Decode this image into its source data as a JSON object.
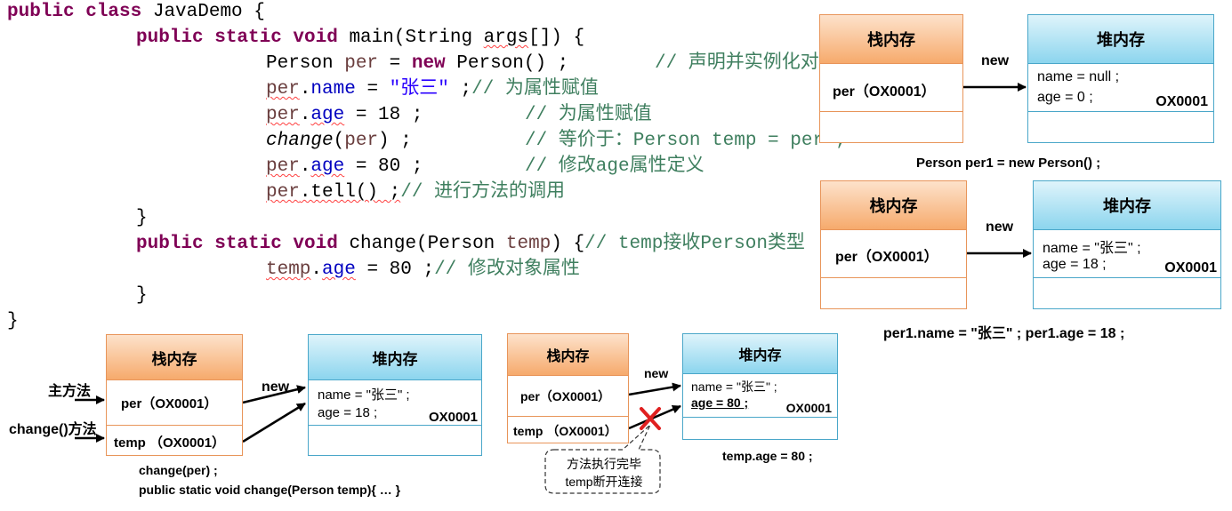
{
  "code": {
    "line1": {
      "kw": "public class",
      "rest": " JavaDemo {"
    },
    "line2": {
      "kw": "public static void",
      "rest": " main(String ",
      "args": "args",
      "tail": "[]) {"
    },
    "line3": {
      "cls": "Person ",
      "var": "per",
      "eq": " = ",
      "kw": "new",
      "rest": " Person() ;",
      "comment": "// 声明并实例化对象"
    },
    "line4": {
      "var": "per",
      "dot": ".",
      "field": "name",
      "eq": " = ",
      "str": "\"张三\"",
      "rest": " ;",
      "comment": "// 为属性赋值"
    },
    "line5": {
      "var": "per",
      "dot": ".",
      "field": "age",
      "rest": " = 18 ;",
      "comment": "// 为属性赋值"
    },
    "line6": {
      "method": "change",
      "open": "(",
      "var": "per",
      "rest": ") ;",
      "comment": "// 等价于：Person temp = per ;"
    },
    "line7": {
      "var": "per",
      "dot": ".",
      "field": "age",
      "rest": " = 80 ;",
      "comment": "// 修改age属性定义"
    },
    "line8": {
      "var": "per",
      "rest": ".tell() ;",
      "comment": "// 进行方法的调用"
    },
    "line9": "}",
    "line10": {
      "kw": "public static void",
      "rest": " change(Person ",
      "var": "temp",
      "tail": ") {",
      "comment": "// temp接收Person类型"
    },
    "line11": {
      "var": "temp",
      "dot": ".",
      "field": "age",
      "rest": " = 80 ;",
      "comment": "// 修改对象属性"
    },
    "line12": "}",
    "line13": "}"
  },
  "colors": {
    "keyword": "#7f0055",
    "field": "#0000c0",
    "string": "#2a00ff",
    "comment": "#3f7f5f",
    "stack_border": "#e8955a",
    "heap_border": "#4aa7c9",
    "cross": "#e02020"
  },
  "d1": {
    "stack_title": "栈内存",
    "heap_title": "堆内存",
    "stack_ref": "per（OX0001）",
    "arrow": "new",
    "heap_line1": "name = null ;",
    "heap_line2": "age = 0 ;",
    "heap_addr": "OX0001",
    "caption": "Person per1 = new Person() ;"
  },
  "d2": {
    "stack_title": "栈内存",
    "heap_title": "堆内存",
    "stack_ref": "per（OX0001）",
    "arrow": "new",
    "heap_line1": "name = \"张三\" ;",
    "heap_line2": "age = 18 ;",
    "heap_addr": "OX0001",
    "caption": "per1.name = \"张三\" ;  per1.age = 18 ;"
  },
  "d3": {
    "stack_title": "栈内存",
    "heap_title": "堆内存",
    "stack_ref1": "per（OX0001）",
    "stack_ref2": "temp （OX0001）",
    "arrow": "new",
    "label_main": "主方法",
    "label_change": "change()方法",
    "heap_line1": "name = \"张三\" ;",
    "heap_line2": "age = 18 ;",
    "heap_addr": "OX0001",
    "caption1": "change(per) ;",
    "caption2": "public static void change(Person temp){ … }"
  },
  "d4": {
    "stack_title": "栈内存",
    "heap_title": "堆内存",
    "stack_ref1": "per（OX0001）",
    "stack_ref2": "temp （OX0001）",
    "arrow": "new",
    "heap_line1": "name = \"张三\" ;",
    "heap_line2": "age = 80 ;",
    "heap_addr": "OX0001",
    "callout_line1": "方法执行完毕",
    "callout_line2": "temp断开连接",
    "caption": "temp.age = 80 ;"
  }
}
